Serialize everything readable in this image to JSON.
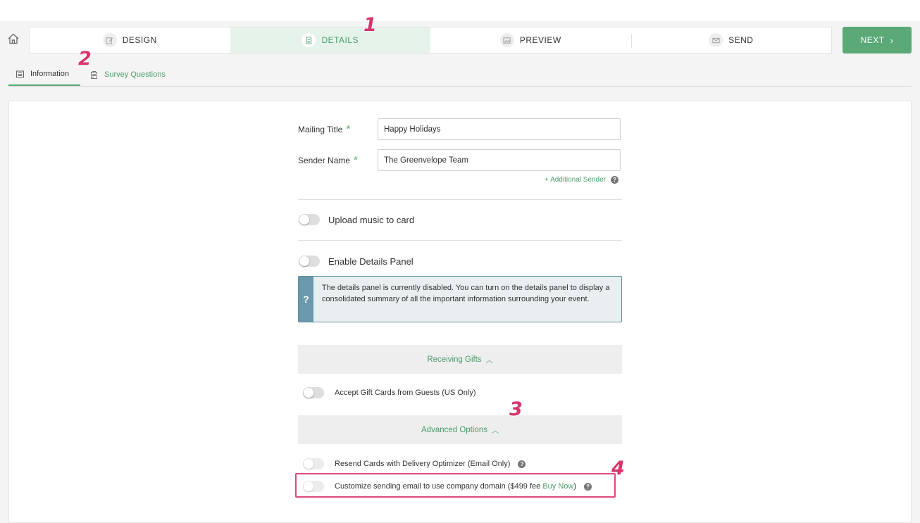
{
  "steps": [
    {
      "label": "DESIGN",
      "icon": "pencil-icon"
    },
    {
      "label": "DETAILS",
      "icon": "document-icon",
      "active": true
    },
    {
      "label": "PREVIEW",
      "icon": "image-icon"
    },
    {
      "label": "SEND",
      "icon": "envelope-icon"
    }
  ],
  "next_button": {
    "label": "NEXT"
  },
  "subtabs": {
    "information": "Information",
    "survey_questions": "Survey Questions"
  },
  "form": {
    "mailing_title_label": "Mailing Title",
    "mailing_title_value": "Happy Holidays",
    "sender_name_label": "Sender Name",
    "sender_name_value": "The Greenvelope Team",
    "required_mark": "*",
    "additional_sender": "+ Additional Sender"
  },
  "toggles": {
    "upload_music": "Upload music to card",
    "enable_details_panel": "Enable Details Panel",
    "accept_gift_cards": "Accept Gift Cards from Guests (US Only)",
    "resend_cards": "Resend Cards with Delivery Optimizer (Email Only)",
    "customize_email_prefix": "Customize sending email to use company domain ($499 fee",
    "customize_email_link": "Buy Now",
    "customize_email_suffix": ")"
  },
  "info_box": {
    "icon_text": "?",
    "text": "The details panel is currently disabled. You can turn on the details panel to display a consolidated summary of all the important information surrounding your event."
  },
  "sections": {
    "receiving_gifts": "Receiving Gifts",
    "advanced_options": "Advanced Options"
  },
  "help_mark": "?",
  "callouts": [
    "1",
    "2",
    "3",
    "4"
  ],
  "colors": {
    "accent": "#5aa977",
    "active_step_bg": "#e6f3ea",
    "info_border": "#5c8fa3",
    "callout": "#d9346d"
  }
}
